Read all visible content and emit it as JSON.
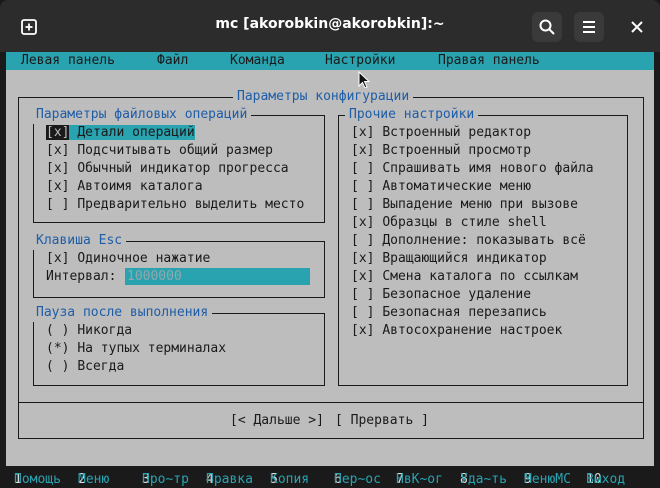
{
  "window": {
    "title": "mc [akorobkin@akorobkin]:~"
  },
  "menubar": {
    "items": [
      "Левая панель",
      "Файл",
      "Команда",
      "Настройки",
      "Правая панель"
    ]
  },
  "dialog": {
    "title": "Параметры конфигурации",
    "file_ops": {
      "title": "Параметры файловых операций",
      "items": [
        {
          "mark": "[x]",
          "label": "Детали операций"
        },
        {
          "mark": "[x]",
          "label": "Подсчитывать общий размер"
        },
        {
          "mark": "[x]",
          "label": "Обычный индикатор прогресса"
        },
        {
          "mark": "[x]",
          "label": "Автоимя каталога"
        },
        {
          "mark": "[ ]",
          "label": "Предварительно выделить место"
        }
      ]
    },
    "esc": {
      "title": "Клавиша Esc",
      "single": {
        "mark": "[x]",
        "label": "Одиночное нажатие"
      },
      "interval_label": "Интервал:",
      "interval_value": "1000000"
    },
    "pause": {
      "title": "Пауза после выполнения",
      "options": [
        {
          "mark": "( )",
          "label": "Никогда"
        },
        {
          "mark": "(*)",
          "label": "На тупых терминалах"
        },
        {
          "mark": "( )",
          "label": "Всегда"
        }
      ]
    },
    "other": {
      "title": "Прочие настройки",
      "items": [
        {
          "mark": "[x]",
          "label": "Встроенный редактор"
        },
        {
          "mark": "[x]",
          "label": "Встроенный просмотр"
        },
        {
          "mark": "[ ]",
          "label": "Спрашивать имя нового файла"
        },
        {
          "mark": "[ ]",
          "label": "Автоматические меню"
        },
        {
          "mark": "[ ]",
          "label": "Выпадение меню при вызове"
        },
        {
          "mark": "[x]",
          "label": "Образцы в стиле shell"
        },
        {
          "mark": "[ ]",
          "label": "Дополнение: показывать всё"
        },
        {
          "mark": "[x]",
          "label": "Вращающийся индикатор"
        },
        {
          "mark": "[x]",
          "label": "Смена каталога по ссылкам"
        },
        {
          "mark": "[ ]",
          "label": "Безопасное удаление"
        },
        {
          "mark": "[ ]",
          "label": "Безопасная перезапись"
        },
        {
          "mark": "[x]",
          "label": "Автосохранение настроек"
        }
      ]
    },
    "buttons": {
      "next": "[< Дальше >]",
      "abort": "[ Прервать ]"
    }
  },
  "fkeys": [
    {
      "key": "1",
      "label": "Помощь"
    },
    {
      "key": "2",
      "label": "Меню"
    },
    {
      "key": "3",
      "label": "Про~тр"
    },
    {
      "key": "4",
      "label": "Правка"
    },
    {
      "key": "5",
      "label": "Копия"
    },
    {
      "key": "6",
      "label": "Пер~ос"
    },
    {
      "key": "7",
      "label": "НвК~ог"
    },
    {
      "key": "8",
      "label": "Уда~ть"
    },
    {
      "key": "9",
      "label": "МенюМС"
    },
    {
      "key": "10",
      "label": "Выход"
    }
  ]
}
